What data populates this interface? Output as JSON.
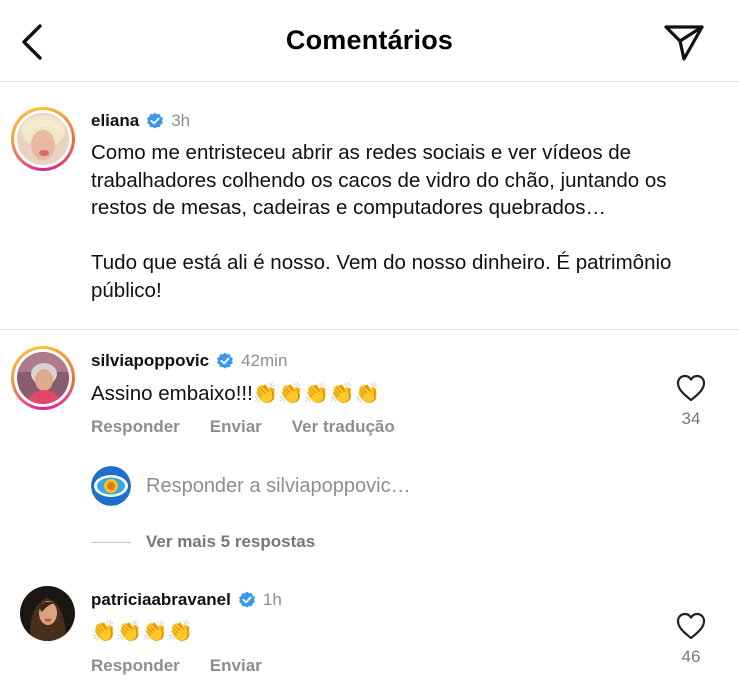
{
  "header": {
    "title": "Comentários",
    "back_icon": "chevron-left-icon",
    "send_icon": "paper-plane-icon"
  },
  "caption": {
    "username": "eliana",
    "time": "3h",
    "paragraph1": "Como me entristeceu abrir as redes sociais e ver vídeos de trabalhadores colhendo os cacos de vidro do chão, juntando os restos de mesas, cadeiras e computadores quebrados…",
    "paragraph2": "Tudo que está ali é nosso. Vem do nosso dinheiro. É patrimônio público!"
  },
  "comments": [
    {
      "username": "silviapoppovic",
      "time": "42min",
      "text": "Assino embaixo!!!",
      "claps": "👏👏👏👏👏",
      "actions": [
        "Responder",
        "Enviar",
        "Ver tradução"
      ],
      "likes": "34"
    },
    {
      "username": "patriciaabravanel",
      "time": "1h",
      "claps": "👏👏👏👏",
      "actions": [
        "Responder",
        "Enviar"
      ],
      "likes": "46"
    }
  ],
  "reply": {
    "placeholder": "Responder a silviapoppovic…"
  },
  "more_replies": "Ver mais 5 respostas",
  "colors": {
    "verified": "#3897f0",
    "muted": "#8e8e8e",
    "divider": "#e0e0e0"
  }
}
